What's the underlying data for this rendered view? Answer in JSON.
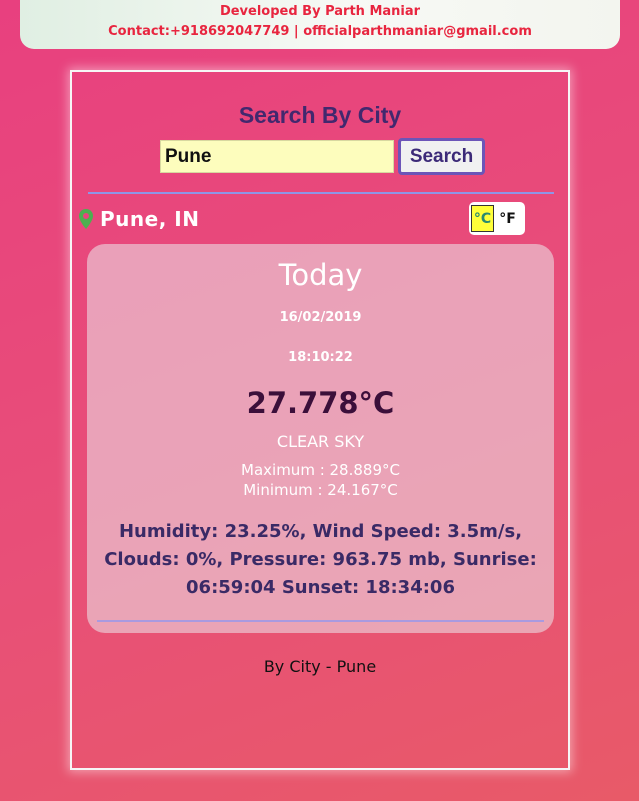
{
  "header": {
    "developer": "Developed By Parth Maniar",
    "contact": "Contact:+918692047749 | officialparthmaniar@gmail.com"
  },
  "search": {
    "title": "Search By City",
    "value": "Pune",
    "button_label": "Search"
  },
  "location": {
    "icon": "map-pin-icon",
    "city": "Pune, IN"
  },
  "units": {
    "celsius": "°C",
    "fahrenheit": "°F",
    "selected": "celsius"
  },
  "weather": {
    "title": "Today",
    "date": "16/02/2019",
    "time": "18:10:22",
    "temperature": "27.778°C",
    "description": "CLEAR SKY",
    "maximum": "Maximum : 28.889°C",
    "minimum": "Minimum : 24.167°C",
    "details": "Humidity: 23.25%, Wind Speed: 3.5m/s, Clouds: 0%, Pressure: 963.75 mb, Sunrise: 06:59:04 Sunset: 18:34:06"
  },
  "footer": {
    "text": "By City - Pune"
  },
  "colors": {
    "background": "#e8407f",
    "banner_text": "#e8253f",
    "search_title": "#42286e",
    "pin": "#4caf50",
    "celsius_active_bg": "#ffff3a"
  }
}
